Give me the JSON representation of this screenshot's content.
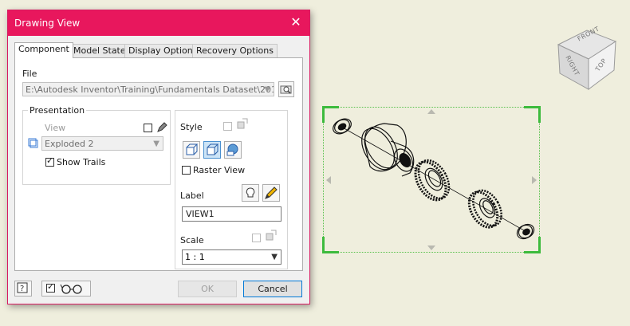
{
  "dialog": {
    "title": "Drawing View",
    "close_glyph": "✕",
    "tabs": [
      {
        "label": "Component",
        "active": true
      },
      {
        "label": "Model State",
        "active": false
      },
      {
        "label": "Display Options",
        "active": false
      },
      {
        "label": "Recovery Options",
        "active": false
      }
    ],
    "file": {
      "label": "File",
      "path": "E:\\Autodesk Inventor\\Training\\Fundamentals Dataset\\2018\\",
      "browse_icon": "browse-folder-icon"
    },
    "presentation": {
      "legend": "Presentation",
      "view_label": "View",
      "view_value": "Exploded 2",
      "show_trails_label": "Show Trails",
      "show_trails_checked": true
    },
    "style": {
      "label": "Style",
      "raster_view_label": "Raster View",
      "raster_view_checked": false
    },
    "label_section": {
      "label": "Label",
      "value": "VIEW1"
    },
    "scale": {
      "label": "Scale",
      "value": "1 : 1"
    },
    "buttons": {
      "ok": "OK",
      "cancel": "Cancel"
    }
  },
  "viewcube": {
    "front": "FRONT",
    "right": "RIGHT",
    "top": "TOP"
  },
  "colors": {
    "title_bar": "#e8175d",
    "canvas_bg": "#efeedd",
    "selection_green": "#3dbb3d"
  }
}
